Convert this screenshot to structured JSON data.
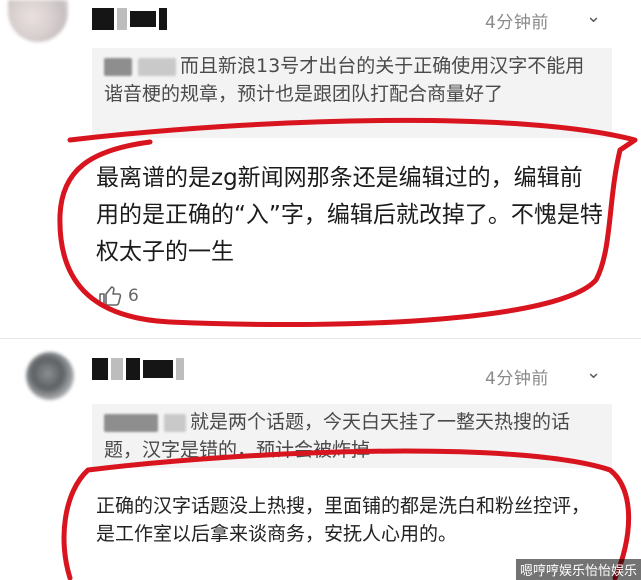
{
  "comments": [
    {
      "time": "4分钟前",
      "quote_rest": "而且新浪13号才出台的关于正确使用汉字不能用谐音梗的规章，预计也是跟团队打配合商量好了",
      "body": "最离谱的是zg新闻网那条还是编辑过的，编辑前用的是正确的“入”字，编辑后就改掉了。不愧是特权太子的一生",
      "likes": "6"
    },
    {
      "time": "4分钟前",
      "quote_rest": "就是两个话题，今天白天挂了一整天热搜的话题，汉字是错的，预计会被炸掉",
      "body": "正确的汉字话题没上热搜，里面铺的都是洗白和粉丝控评，是工作室以后拿来谈商务，安抚人心用的。"
    }
  ],
  "icons": {
    "more": "chevron-down-icon",
    "like": "thumbs-up-icon"
  },
  "colors": {
    "annotation": "#d8141f",
    "quote_bg": "#f3f3f3"
  },
  "watermark": "嗯哼哼娱乐怡怡娱乐"
}
